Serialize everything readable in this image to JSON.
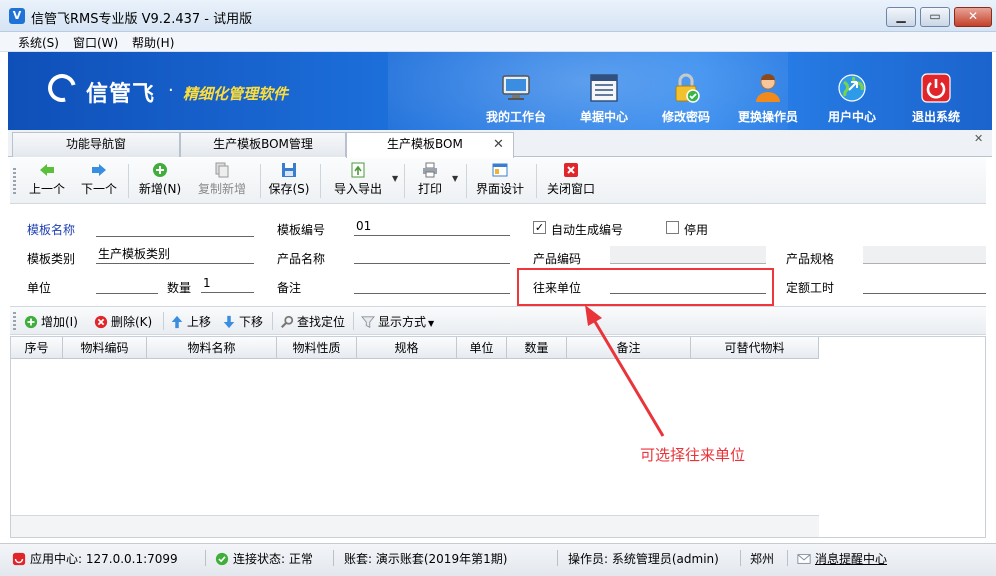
{
  "window": {
    "title": "信管飞RMS专业版 V9.2.437 - 试用版",
    "minimize": "▁",
    "maximize": "▭",
    "close": "✕"
  },
  "menu": [
    "系统(S)",
    "窗口(W)",
    "帮助(H)"
  ],
  "banner": {
    "logo": "信管飞",
    "dot": "·",
    "slogan": "精细化管理软件",
    "tools": [
      {
        "label": "我的工作台",
        "icon": "monitor-icon"
      },
      {
        "label": "单据中心",
        "icon": "document-list-icon"
      },
      {
        "label": "修改密码",
        "icon": "lock-icon"
      },
      {
        "label": "更换操作员",
        "icon": "user-icon"
      },
      {
        "label": "用户中心",
        "icon": "globe-icon"
      },
      {
        "label": "退出系统",
        "icon": "power-icon"
      }
    ]
  },
  "tabs": [
    {
      "label": "功能导航窗",
      "active": false
    },
    {
      "label": "生产模板BOM管理",
      "active": false
    },
    {
      "label": "生产模板BOM",
      "active": true
    }
  ],
  "tab_close": "✕",
  "strip_close": "✕",
  "toolbar": {
    "prev": "上一个",
    "next": "下一个",
    "add": "新增(N)",
    "copy_add": "复制新增",
    "save": "保存(S)",
    "import_export": "导入导出",
    "print": "打印",
    "ui_design": "界面设计",
    "close_window": "关闭窗口"
  },
  "form": {
    "template_name_label": "模板名称",
    "template_name_value": "",
    "template_no_label": "模板编号",
    "template_no_value": "01",
    "auto_number_label": "自动生成编号",
    "auto_number_checked": true,
    "disabled_label": "停用",
    "disabled_checked": false,
    "template_type_label": "模板类别",
    "template_type_value": "生产模板类别",
    "product_name_label": "产品名称",
    "product_name_value": "",
    "product_code_label": "产品编码",
    "product_code_value": "",
    "product_spec_label": "产品规格",
    "product_spec_value": "",
    "unit_label": "单位",
    "unit_value": "",
    "qty_label": "数量",
    "qty_value": "1",
    "remark_label": "备注",
    "remark_value": "",
    "partner_label": "往来单位",
    "partner_value": "",
    "quota_hours_label": "定额工时",
    "quota_hours_value": ""
  },
  "detail_toolbar": {
    "add": "增加(I)",
    "delete": "删除(K)",
    "move_up": "上移",
    "move_down": "下移",
    "find": "查找定位",
    "display_mode": "显示方式"
  },
  "grid": {
    "columns": [
      "序号",
      "物料编码",
      "物料名称",
      "物料性质",
      "规格",
      "单位",
      "数量",
      "备注",
      "可替代物料"
    ],
    "rows": []
  },
  "annotation": "可选择往来单位",
  "colors": {
    "banner": "#1f74e0",
    "annotation_red": "#e9343a",
    "label_blue": "#1e3fb4"
  },
  "status": {
    "app_center": "应用中心: 127.0.0.1:7099",
    "connection": "连接状态: 正常",
    "account": "账套: 演示账套(2019年第1期)",
    "operator": "操作员: 系统管理员(admin)",
    "city": "郑州",
    "messages": "消息提醒中心"
  }
}
